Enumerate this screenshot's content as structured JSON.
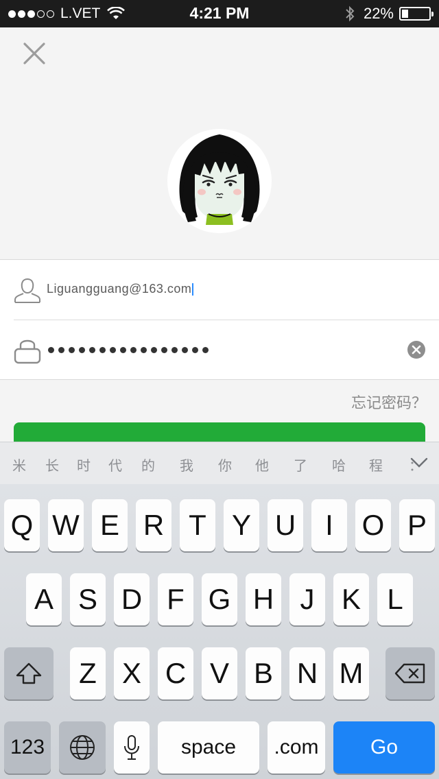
{
  "status_bar": {
    "carrier": "L.VET",
    "time": "4:21 PM",
    "battery_percent": "22%",
    "signal_bars_filled": 3,
    "signal_bars_total": 5,
    "battery_level": 0.22
  },
  "login_form": {
    "username_value": "Liguangguang@163.com",
    "password_mask_length": 16,
    "forgot_password_label": "忘记密码？"
  },
  "candidate_bar": {
    "candidates": [
      "米",
      "长",
      "时",
      "代",
      "的",
      "我",
      "你",
      "他",
      "了",
      "哈",
      "程",
      "："
    ]
  },
  "keyboard": {
    "row1": [
      "Q",
      "W",
      "E",
      "R",
      "T",
      "Y",
      "U",
      "I",
      "O",
      "P"
    ],
    "row2": [
      "A",
      "S",
      "D",
      "F",
      "G",
      "H",
      "J",
      "K",
      "L"
    ],
    "row3": [
      "Z",
      "X",
      "C",
      "V",
      "B",
      "N",
      "M"
    ],
    "numbers_key": "123",
    "space_key": "space",
    "dotcom_key": ".com",
    "go_key": "Go"
  },
  "colors": {
    "accent_green": "#22ab38",
    "go_blue": "#1c84f7",
    "status_bar_bg": "#1c1c1c",
    "background": "#f4f4f4"
  },
  "icons": {
    "close": "close-icon",
    "user": "user-icon",
    "lock": "lock-icon",
    "clear": "clear-input-icon",
    "shift": "shift-icon",
    "backspace": "backspace-icon",
    "globe": "globe-icon",
    "mic": "microphone-icon",
    "wifi": "wifi-icon",
    "bluetooth": "bluetooth-icon"
  }
}
